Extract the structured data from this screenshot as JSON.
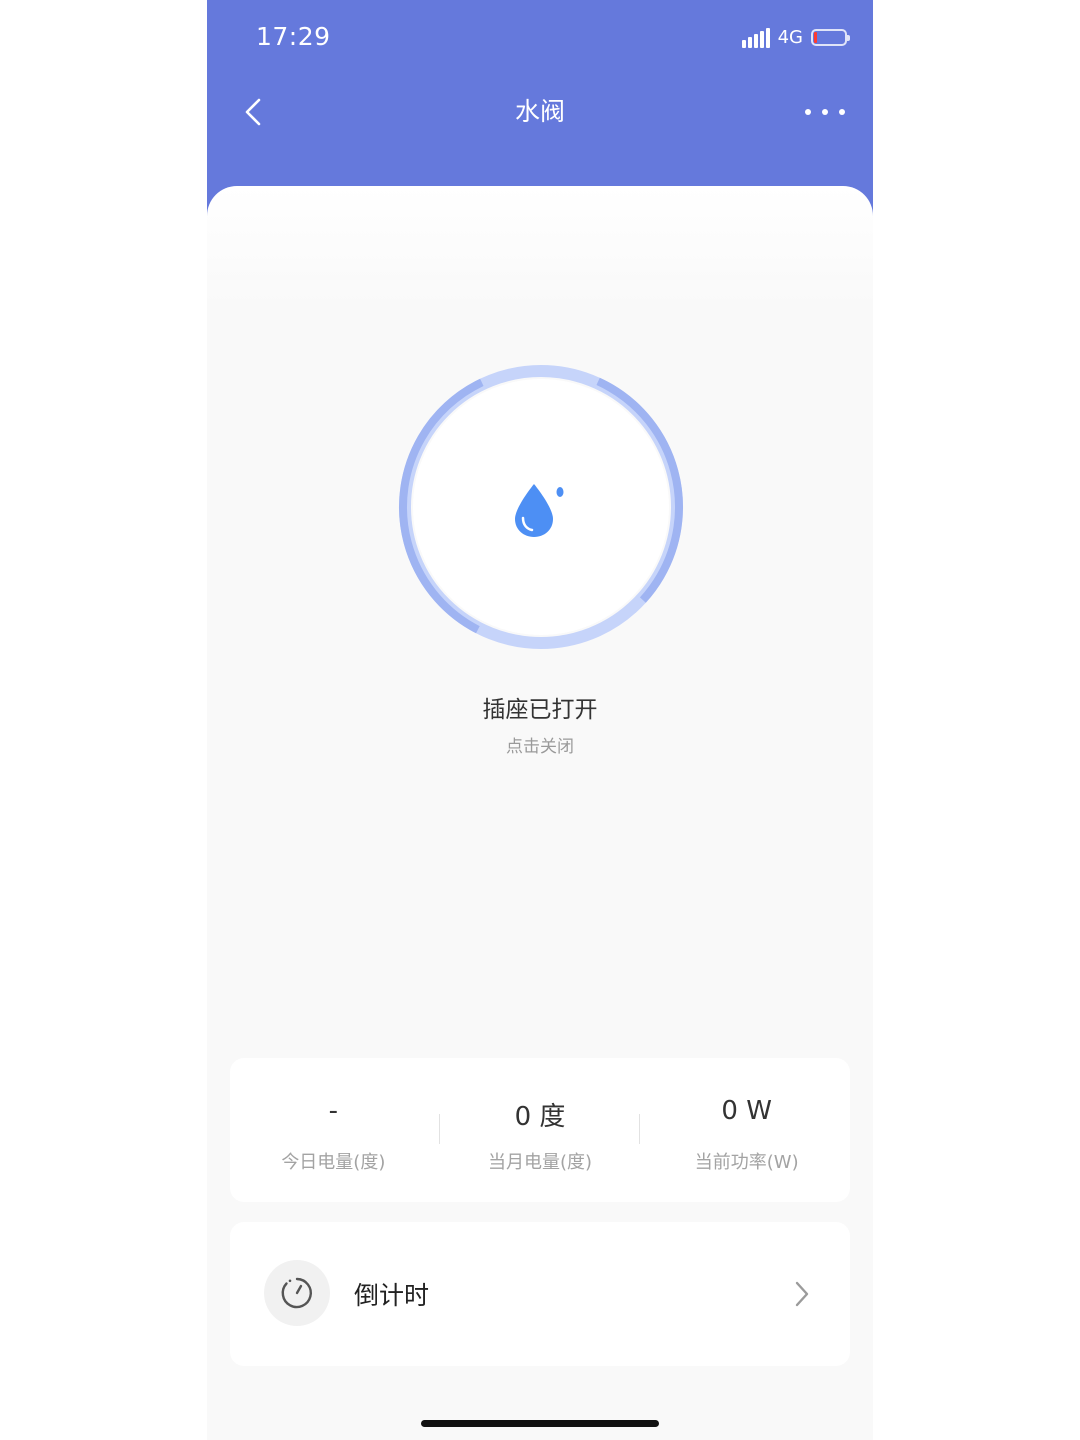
{
  "status_bar": {
    "time": "17:29",
    "network": "4G",
    "icons": [
      "signal-icon",
      "battery-icon"
    ],
    "battery_level": 0.08
  },
  "nav": {
    "title": "水阀",
    "back_icon": "chevron-left-icon",
    "more_icon": "more-dots-icon"
  },
  "device": {
    "icon": "water-drop-icon",
    "status_title": "插座已打开",
    "status_action": "点击关闭"
  },
  "stats": [
    {
      "value": "-",
      "label": "今日电量(度)"
    },
    {
      "value": "0 度",
      "label": "当月电量(度)"
    },
    {
      "value": "0 W",
      "label": "当前功率(W)"
    }
  ],
  "timer": {
    "label": "倒计时",
    "icon": "timer-icon",
    "arrow_icon": "chevron-right-icon"
  },
  "colors": {
    "header": "#6579dc",
    "ring": "#9fb4f2",
    "drop": "#4d8ff4",
    "battery_low": "#ff3b30"
  }
}
